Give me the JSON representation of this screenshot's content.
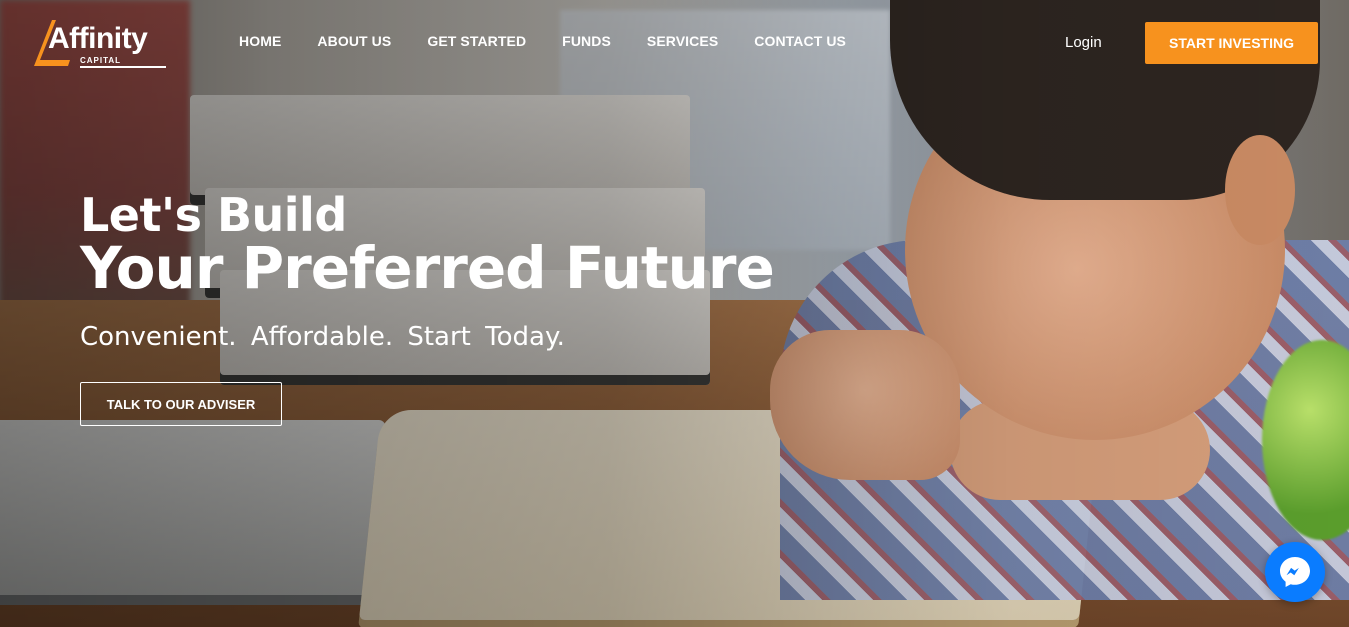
{
  "brand": {
    "name": "Affinity",
    "sub": "CAPITAL",
    "accent": "#f7921e"
  },
  "nav": {
    "items": [
      {
        "label": "HOME"
      },
      {
        "label": "ABOUT US"
      },
      {
        "label": "GET STARTED"
      },
      {
        "label": "FUNDS"
      },
      {
        "label": "SERVICES"
      },
      {
        "label": "CONTACT US"
      }
    ],
    "login": "Login",
    "cta": "START INVESTING"
  },
  "hero": {
    "line1": "Let's Build",
    "line2": "Your Preferred Future",
    "tagline": "Convenient.  Affordable.  Start Today.",
    "button": "TALK TO OUR ADVISER",
    "image_subject": "boy reading a book at a table"
  },
  "chat_widget": {
    "icon": "messenger-icon",
    "color": "#0a7cff"
  }
}
